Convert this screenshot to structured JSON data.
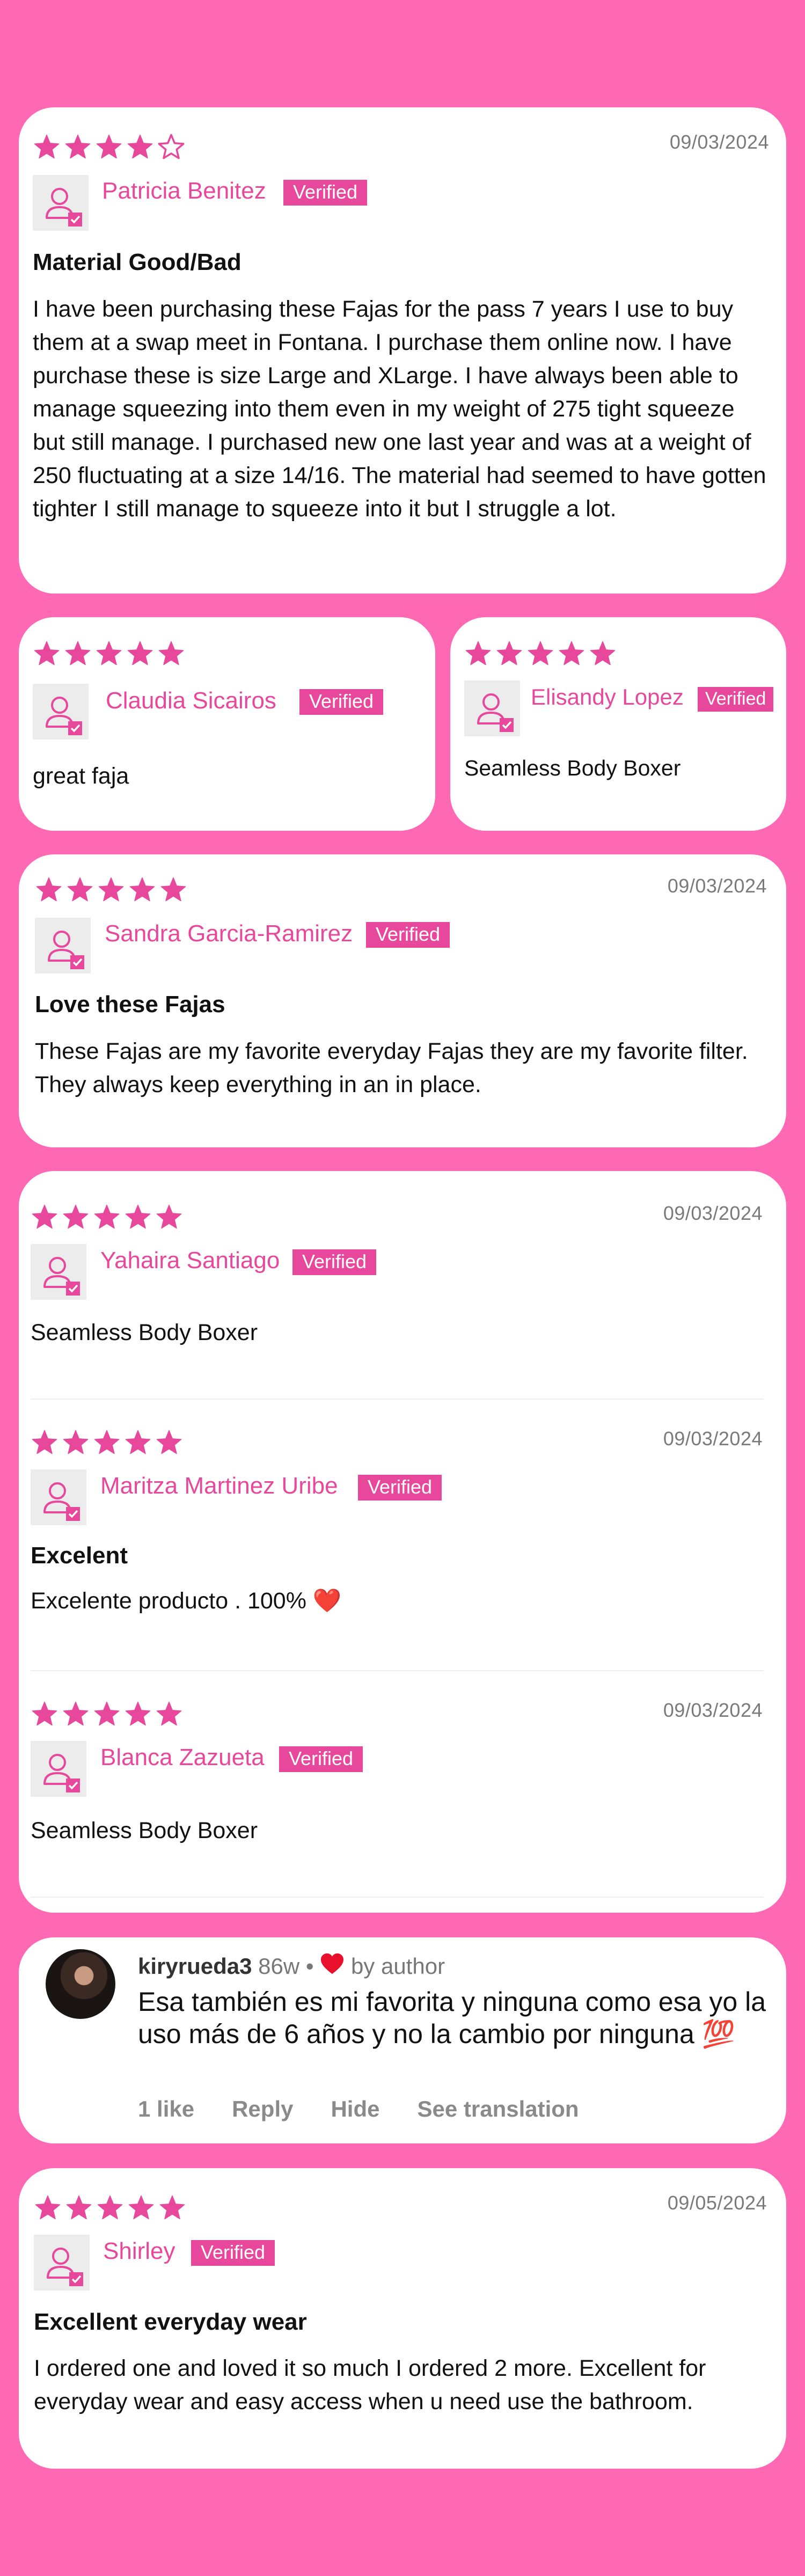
{
  "colors": {
    "background": "#ff69b4",
    "accent": "#e8489c",
    "star": "#e8489c",
    "heart": "#e8102d"
  },
  "verified_label": "Verified",
  "reviews": [
    {
      "rating": 4,
      "date": "09/03/2024",
      "name": "Patricia Benitez",
      "title": "Material Good/Bad",
      "body": "I have been purchasing these Fajas for the pass 7 years I use to buy them at a swap meet in Fontana. I purchase them online now. I have purchase these is size Large and XLarge. I have always been able to manage squeezing into them even in my weight of 275 tight squeeze but still manage. I purchased new one last year and was at a weight of 250 fluctuating at a size 14/16. The material had seemed to have gotten tighter I still manage to squeeze into it but I struggle a lot."
    },
    {
      "rating": 5,
      "name": "Claudia Sicairos",
      "body": "great faja"
    },
    {
      "rating": 5,
      "name": "Elisandy Lopez",
      "body": "Seamless Body Boxer"
    },
    {
      "rating": 5,
      "date": "09/03/2024",
      "name": "Sandra Garcia-Ramirez",
      "title": "Love these Fajas",
      "body": "These Fajas are my favorite everyday Fajas they are my favorite filter. They always keep everything in an in place."
    },
    {
      "rating": 5,
      "date": "09/03/2024",
      "name": "Yahaira Santiago",
      "body": "Seamless Body Boxer"
    },
    {
      "rating": 5,
      "date": "09/03/2024",
      "name": "Maritza Martinez Uribe",
      "title": "Excelent",
      "body": "Excelente producto . 100% ❤️"
    },
    {
      "rating": 5,
      "date": "09/03/2024",
      "name": "Blanca Zazueta",
      "body": "Seamless Body Boxer"
    },
    {
      "rating": 5,
      "date": "09/05/2024",
      "name": "Shirley",
      "title": "Excellent everyday wear",
      "body": "I ordered one and loved it so much I ordered 2 more. Excellent for everyday wear and easy access when u need use the bathroom."
    }
  ],
  "comment": {
    "username": "kiryrueda3",
    "age": "86w",
    "separator": "•",
    "liked_by": "by author",
    "text": "Esa también es mi favorita y ninguna como esa yo la uso más de 6 años y no la cambio por ninguna 💯",
    "actions": {
      "likes": "1 like",
      "reply": "Reply",
      "hide": "Hide",
      "translate": "See translation"
    }
  }
}
